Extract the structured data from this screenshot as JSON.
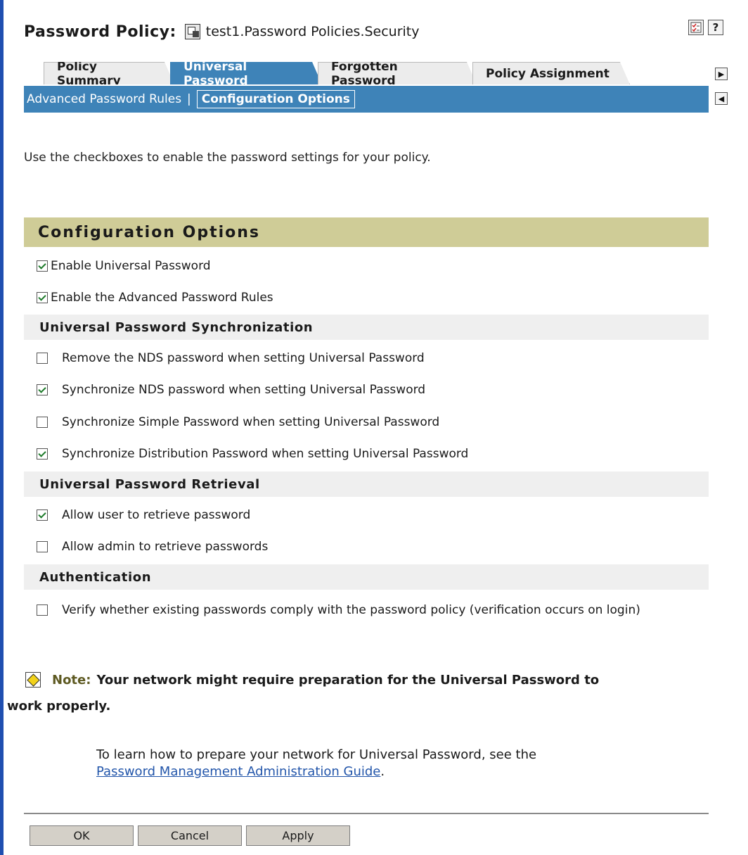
{
  "header": {
    "title": "Password Policy:",
    "object_name": "test1.Password Policies.Security",
    "help_glyph": "?"
  },
  "tabs": [
    {
      "label": "Policy Summary",
      "active": false
    },
    {
      "label": "Universal Password",
      "active": true
    },
    {
      "label": "Forgotten Password",
      "active": false
    },
    {
      "label": "Policy Assignment",
      "active": false
    }
  ],
  "subnav": {
    "items": [
      "Advanced Password Rules",
      "Configuration Options"
    ],
    "separator": "|",
    "active_index": 1
  },
  "intro": "Use the checkboxes to enable the password settings for your policy.",
  "section_title": "Configuration Options",
  "main_options": [
    {
      "label": "Enable Universal Password",
      "checked": true
    },
    {
      "label": "Enable the Advanced Password Rules",
      "checked": true
    }
  ],
  "sync": {
    "title": "Universal Password Synchronization",
    "options": [
      {
        "label": "Remove the NDS password when setting Universal Password",
        "checked": false
      },
      {
        "label": "Synchronize NDS password when setting Universal Password",
        "checked": true
      },
      {
        "label": "Synchronize Simple Password when setting Universal Password",
        "checked": false
      },
      {
        "label": "Synchronize Distribution Password when setting Universal Password",
        "checked": true
      }
    ]
  },
  "retrieval": {
    "title": "Universal Password Retrieval",
    "options": [
      {
        "label": "Allow user to retrieve password",
        "checked": true
      },
      {
        "label": "Allow admin to retrieve passwords",
        "checked": false
      }
    ]
  },
  "auth": {
    "title": "Authentication",
    "option": {
      "label": "Verify whether existing passwords comply with the password policy (verification occurs on login)",
      "checked": false
    }
  },
  "note": {
    "prefix": "Note:",
    "line1": "Your network might require preparation for the Universal Password to",
    "line2": "work properly.",
    "guide_text": "To learn how to prepare your network for Universal Password, see the",
    "guide_link": "Password Management Administration Guide",
    "guide_end": "."
  },
  "buttons": {
    "ok": "OK",
    "cancel": "Cancel",
    "apply": "Apply"
  }
}
